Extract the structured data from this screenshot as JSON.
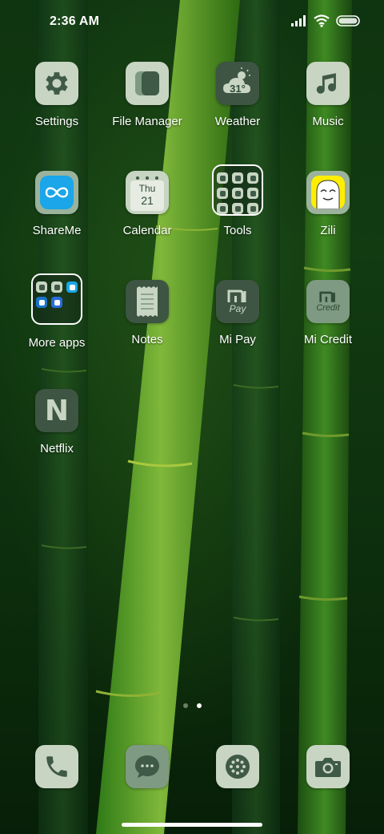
{
  "status_bar": {
    "time": "2:36 AM"
  },
  "apps": [
    {
      "id": "settings",
      "label": "Settings",
      "icon": "gear-icon"
    },
    {
      "id": "file-manager",
      "label": "File Manager",
      "icon": "folder-icon"
    },
    {
      "id": "weather",
      "label": "Weather",
      "icon": "weather-cloud-icon",
      "temperature": "31°"
    },
    {
      "id": "music",
      "label": "Music",
      "icon": "music-note-icon"
    },
    {
      "id": "shareme",
      "label": "ShareMe",
      "icon": "infinity-icon"
    },
    {
      "id": "calendar",
      "label": "Calendar",
      "icon": "calendar-icon",
      "day_name": "Thu",
      "day_number": "21"
    },
    {
      "id": "tools",
      "label": "Tools",
      "icon": "folder-grid-icon",
      "type": "folder"
    },
    {
      "id": "zili",
      "label": "Zili",
      "icon": "zili-face-icon"
    },
    {
      "id": "more-apps",
      "label": "More apps",
      "icon": "folder-grid-icon",
      "type": "folder"
    },
    {
      "id": "notes",
      "label": "Notes",
      "icon": "notes-icon"
    },
    {
      "id": "mi-pay",
      "label": "Mi Pay",
      "icon": "mi-pay-icon",
      "icon_text": "Pay"
    },
    {
      "id": "mi-credit",
      "label": "Mi Credit",
      "icon": "mi-credit-icon",
      "icon_text": "Credit"
    },
    {
      "id": "netflix",
      "label": "Netflix",
      "icon": "netflix-icon",
      "icon_text": "N"
    }
  ],
  "page_indicator": {
    "pages": 2,
    "current": 2
  },
  "dock": [
    {
      "id": "phone",
      "icon": "phone-icon"
    },
    {
      "id": "messages",
      "icon": "chat-bubble-icon"
    },
    {
      "id": "browser",
      "icon": "browser-dots-icon"
    },
    {
      "id": "camera",
      "icon": "camera-icon"
    }
  ],
  "colors": {
    "icon_tile": "#c8d5c3",
    "icon_glyph": "#3f5a46",
    "wallpaper": "#123b12"
  }
}
